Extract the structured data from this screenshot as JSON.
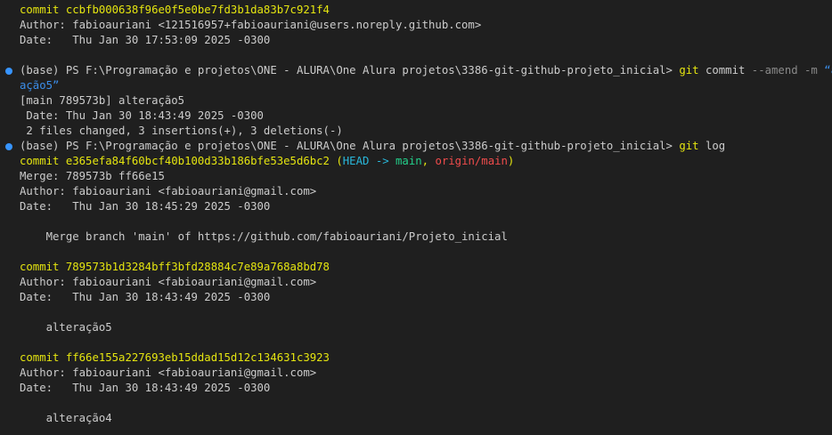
{
  "commit_word": "commit",
  "head_label": "HEAD",
  "arrow": "->",
  "branch_main": "main",
  "branch_origin": "origin/main",
  "open_paren": "(",
  "comma": ",",
  "close_paren": ")",
  "prev_commit": {
    "hash": "ccbfb000638f96e0f5e0be7fd3b1da83b7c921f4",
    "author": "Author: fabioauriani <121516957+fabioauriani@users.noreply.github.com>",
    "date": "Date:   Thu Jan 30 17:53:09 2025 -0300"
  },
  "prompt1": {
    "prefix": "(base) PS F:\\Programação e projetos\\ONE - ALURA\\One Alura projetos\\3386-git-github-projeto_inicial>",
    "git": "git",
    "sub": "commit",
    "flags": "--amend -m",
    "message_line1": "“alter",
    "message_line2": "ação5”"
  },
  "amend_output": {
    "line1": "[main 789573b] alteração5",
    "line2": " Date: Thu Jan 30 18:43:49 2025 -0300",
    "line3": " 2 files changed, 3 insertions(+), 3 deletions(-)"
  },
  "prompt2": {
    "prefix": "(base) PS F:\\Programação e projetos\\ONE - ALURA\\One Alura projetos\\3386-git-github-projeto_inicial>",
    "git": "git",
    "sub": "log"
  },
  "log": [
    {
      "hash": "e365efa84f60bcf40b100d33b186bfe53e5d6bc2",
      "merge": "Merge: 789573b ff66e15",
      "author": "Author: fabioauriani <fabioauriani@gmail.com>",
      "date": "Date:   Thu Jan 30 18:45:29 2025 -0300",
      "message": "    Merge branch 'main' of https://github.com/fabioauriani/Projeto_inicial"
    },
    {
      "hash": "789573b1d3284bff3bfd28884c7e89a768a8bd78",
      "author": "Author: fabioauriani <fabioauriani@gmail.com>",
      "date": "Date:   Thu Jan 30 18:43:49 2025 -0300",
      "message": "    alteração5"
    },
    {
      "hash": "ff66e155a227693eb15ddad15d12c134631c3923",
      "author": "Author: fabioauriani <fabioauriani@gmail.com>",
      "date": "Date:   Thu Jan 30 18:43:49 2025 -0300",
      "message": "    alteração4"
    }
  ]
}
